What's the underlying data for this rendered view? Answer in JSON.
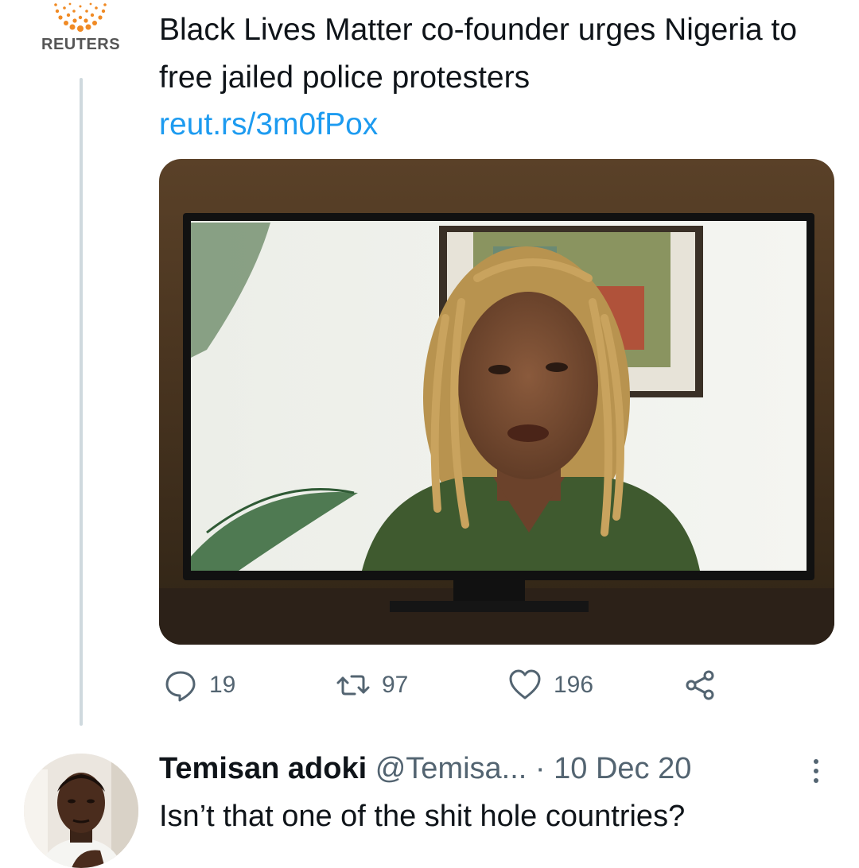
{
  "tweet": {
    "author_logo_text": "REUTERS",
    "headline": "Black Lives Matter co-founder urges Nigeria to free jailed police protesters",
    "link": "reut.rs/3m0fPox",
    "actions": {
      "replies": "19",
      "retweets": "97",
      "likes": "196"
    }
  },
  "reply": {
    "name": "Temisan adoki",
    "handle": "@Temisa...",
    "separator": "·",
    "date": "10 Dec 20",
    "text": "Isn’t that one of the shit hole countries?"
  },
  "colors": {
    "link": "#1d9bf0",
    "secondary_text": "#536471",
    "reuters_orange": "#f08a24",
    "thread_line": "#cfd9de"
  }
}
